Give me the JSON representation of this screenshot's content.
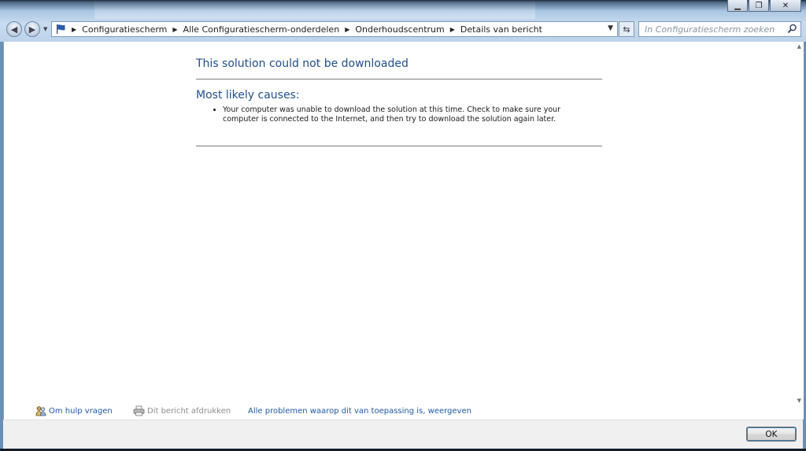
{
  "window": {
    "minimize_icon": "minimize-icon",
    "maximize_icon": "maximize-icon",
    "close_label": "✕"
  },
  "navigation": {
    "breadcrumbs": [
      "Configuratiescherm",
      "Alle Configuratiescherm-onderdelen",
      "Onderhoudscentrum",
      "Details van bericht"
    ],
    "search_placeholder": "In Configuratiescherm zoeken"
  },
  "message": {
    "title": "This solution could not be downloaded",
    "causes_heading": "Most likely causes:",
    "causes": [
      "Your computer was unable to download the solution at this time. Check to make sure your computer is connected to the Internet, and then try to download the solution again later."
    ]
  },
  "footer": {
    "help_link": "Om hulp vragen",
    "print_link": "Dit bericht afdrukken",
    "problems_link": "Alle problemen waarop dit van toepassing is, weergeven"
  },
  "dialog": {
    "ok_label": "OK"
  },
  "colors": {
    "heading": "#1f4e8c",
    "link": "#1e5aa8",
    "disabled_link": "#8e8e8e"
  }
}
